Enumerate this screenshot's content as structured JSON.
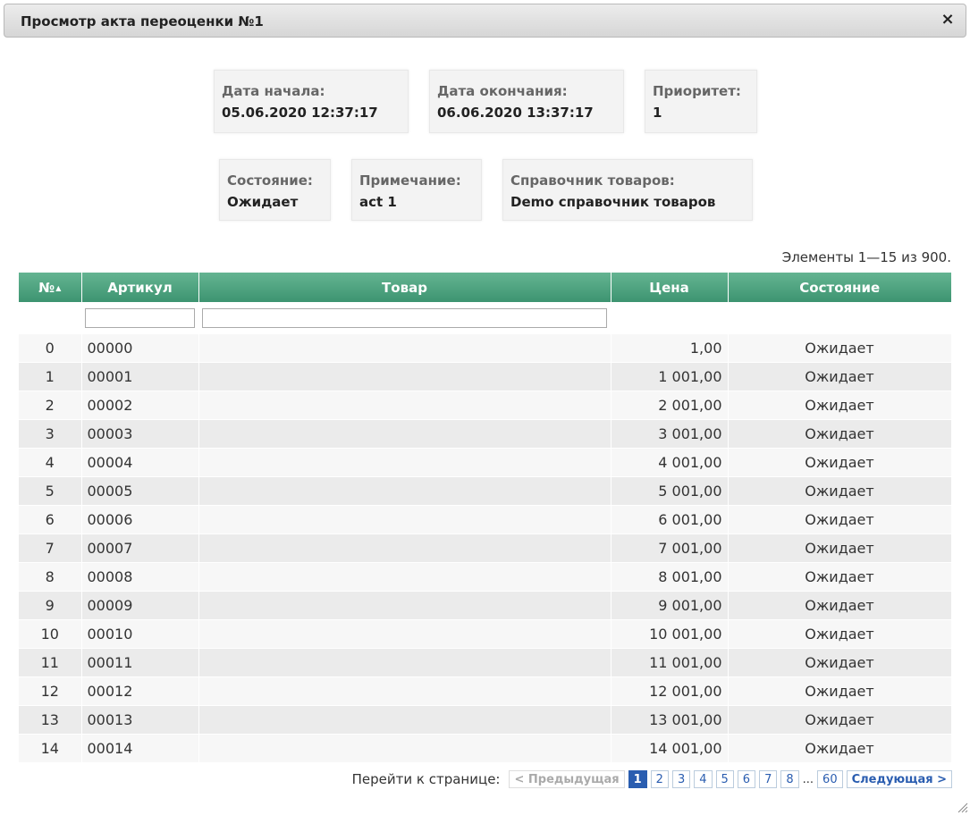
{
  "dialog": {
    "title": "Просмотр акта переоценки №1",
    "close_label": "×"
  },
  "cards": {
    "start": {
      "label": "Дата начала:",
      "value": "05.06.2020 12:37:17"
    },
    "end": {
      "label": "Дата окончания:",
      "value": "06.06.2020 13:37:17"
    },
    "priority": {
      "label": "Приоритет:",
      "value": "1"
    },
    "state": {
      "label": "Состояние:",
      "value": "Ожидает"
    },
    "note": {
      "label": "Примечание:",
      "value": "act 1"
    },
    "catalog": {
      "label": "Справочник товаров:",
      "value": "Demo справочник товаров"
    }
  },
  "summary": "Элементы 1—15 из 900.",
  "table": {
    "headers": {
      "num": "№",
      "article": "Артикул",
      "product": "Товар",
      "price": "Цена",
      "state": "Состояние"
    },
    "rows": [
      {
        "num": "0",
        "article": "00000",
        "product": "",
        "price": "1,00",
        "state": "Ожидает"
      },
      {
        "num": "1",
        "article": "00001",
        "product": "",
        "price": "1 001,00",
        "state": "Ожидает"
      },
      {
        "num": "2",
        "article": "00002",
        "product": "",
        "price": "2 001,00",
        "state": "Ожидает"
      },
      {
        "num": "3",
        "article": "00003",
        "product": "",
        "price": "3 001,00",
        "state": "Ожидает"
      },
      {
        "num": "4",
        "article": "00004",
        "product": "",
        "price": "4 001,00",
        "state": "Ожидает"
      },
      {
        "num": "5",
        "article": "00005",
        "product": "",
        "price": "5 001,00",
        "state": "Ожидает"
      },
      {
        "num": "6",
        "article": "00006",
        "product": "",
        "price": "6 001,00",
        "state": "Ожидает"
      },
      {
        "num": "7",
        "article": "00007",
        "product": "",
        "price": "7 001,00",
        "state": "Ожидает"
      },
      {
        "num": "8",
        "article": "00008",
        "product": "",
        "price": "8 001,00",
        "state": "Ожидает"
      },
      {
        "num": "9",
        "article": "00009",
        "product": "",
        "price": "9 001,00",
        "state": "Ожидает"
      },
      {
        "num": "10",
        "article": "00010",
        "product": "",
        "price": "10 001,00",
        "state": "Ожидает"
      },
      {
        "num": "11",
        "article": "00011",
        "product": "",
        "price": "11 001,00",
        "state": "Ожидает"
      },
      {
        "num": "12",
        "article": "00012",
        "product": "",
        "price": "12 001,00",
        "state": "Ожидает"
      },
      {
        "num": "13",
        "article": "00013",
        "product": "",
        "price": "13 001,00",
        "state": "Ожидает"
      },
      {
        "num": "14",
        "article": "00014",
        "product": "",
        "price": "14 001,00",
        "state": "Ожидает"
      }
    ]
  },
  "pager": {
    "goto_label": "Перейти к странице:",
    "prev": "< Предыдущая",
    "next": "Следующая >",
    "pages": [
      "1",
      "2",
      "3",
      "4",
      "5",
      "6",
      "7",
      "8"
    ],
    "ellipsis": "...",
    "last": "60",
    "current": "1"
  },
  "colors": {
    "header_green": "#3d9471",
    "link_blue": "#2a5db0"
  }
}
